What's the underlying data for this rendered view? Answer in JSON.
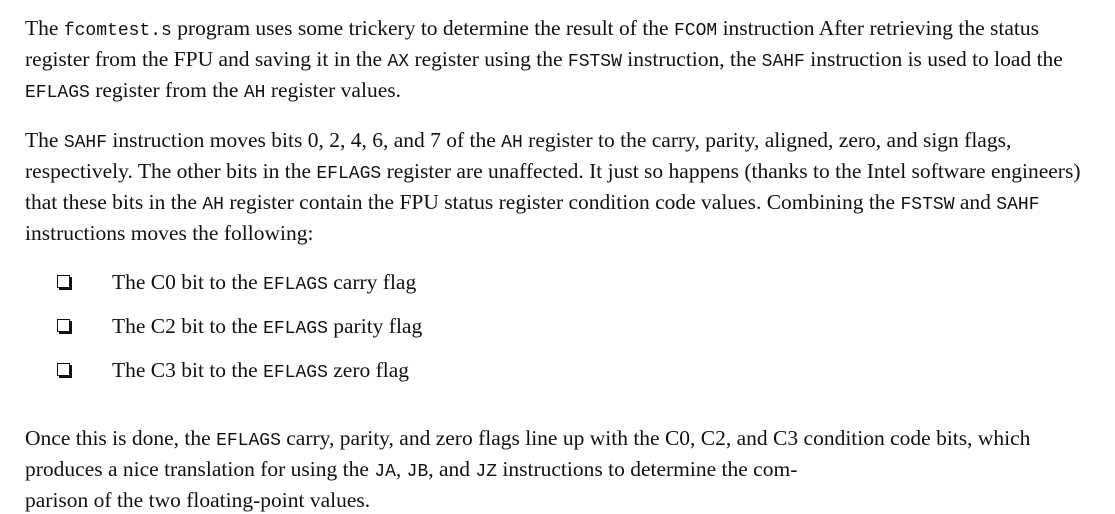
{
  "paragraph1": {
    "s1": "The ",
    "c1": "fcomtest.s",
    "s2": " program uses some trickery to determine the result of the ",
    "c2": "FCOM",
    "s3": " instruction After retrieving the status register from the FPU and saving it in the ",
    "c3": "AX",
    "s4": " register using the ",
    "c4": "FSTSW",
    "s5": " instruction, the ",
    "c5": "SAHF",
    "s6": " instruction is used to load the ",
    "c6": "EFLAGS",
    "s7": " register from the ",
    "c7": "AH",
    "s8": " register values."
  },
  "paragraph2": {
    "s1": "The ",
    "c1": "SAHF",
    "s2": " instruction moves bits 0, 2, 4, 6, and 7 of the ",
    "c2": "AH",
    "s3": " register to the carry, parity, aligned, zero, and sign flags, respectively. The other bits in the ",
    "c3": "EFLAGS",
    "s4": " register are unaffected. It just so happens (thanks to the Intel software engineers) that these bits in the ",
    "c4": "AH",
    "s5": " register contain the FPU status register condition code values. Combining the ",
    "c5": "FSTSW",
    "s6": " and ",
    "c6": "SAHF",
    "s7": " instructions moves the following:"
  },
  "list": [
    {
      "pre": "The C0 bit to the ",
      "code": "EFLAGS",
      "post": " carry flag"
    },
    {
      "pre": "The C2 bit to the ",
      "code": "EFLAGS",
      "post": " parity flag"
    },
    {
      "pre": "The C3 bit to the ",
      "code": "EFLAGS",
      "post": " zero flag"
    }
  ],
  "paragraph3": {
    "s1": "Once this is done, the ",
    "c1": "EFLAGS",
    "s2": " carry, parity, and zero flags line up with the C0, C2, and C3 condition code bits, which produces a nice translation for using the ",
    "c2": "JA",
    "s3": ", ",
    "c3": "JB",
    "s4": ", and ",
    "c4": "JZ",
    "s5": " instructions to determine the com-",
    "s6": "parison of the two floating-point values."
  }
}
